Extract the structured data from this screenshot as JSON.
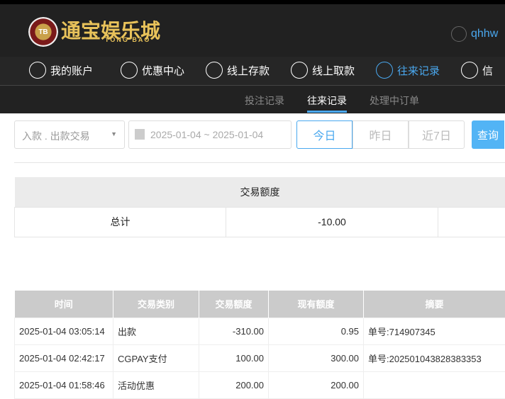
{
  "header": {
    "logo_cn": "通宝娱乐城",
    "logo_en": "TONG BAO",
    "logo_chip": "TB",
    "username": "qhhw"
  },
  "nav": [
    {
      "label": "我的账户",
      "icon": "user-icon"
    },
    {
      "label": "优惠中心",
      "icon": "gift-icon"
    },
    {
      "label": "线上存款",
      "icon": "deposit-icon"
    },
    {
      "label": "线上取款",
      "icon": "withdraw-icon"
    },
    {
      "label": "往来记录",
      "icon": "records-icon",
      "active": true
    },
    {
      "label": "信",
      "icon": "bell-icon"
    }
  ],
  "subnav": [
    {
      "label": "投注记录"
    },
    {
      "label": "往来记录",
      "active": true
    },
    {
      "label": "处理中订单"
    }
  ],
  "filters": {
    "type": "入款 . 出款交易",
    "date_range": "2025-01-04 ~ 2025-01-04",
    "quick": [
      "今日",
      "昨日",
      "近7日"
    ],
    "search": "查询"
  },
  "summary": {
    "header": "交易额度",
    "label": "总计",
    "value": "-10.00"
  },
  "table": {
    "headers": [
      "时间",
      "交易类别",
      "交易额度",
      "现有额度",
      "摘要"
    ],
    "rows": [
      [
        "2025-01-04 03:05:14",
        "出款",
        "-310.00",
        "0.95",
        "单号:714907345"
      ],
      [
        "2025-01-04 02:42:17",
        "CGPAY支付",
        "100.00",
        "300.00",
        "单号:202501043828383353"
      ],
      [
        "2025-01-04 01:58:46",
        "活动优惠",
        "200.00",
        "200.00",
        ""
      ]
    ]
  },
  "colors": {
    "accent": "#4aa8ef",
    "header_bg": "#212121"
  }
}
